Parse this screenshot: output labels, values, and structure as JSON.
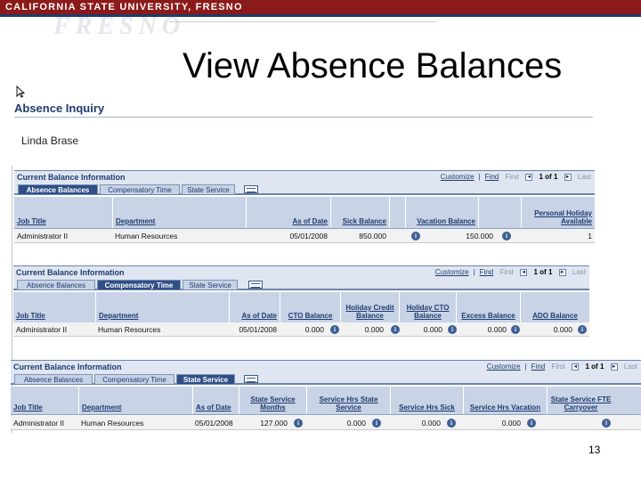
{
  "banner": {
    "text": "CALIFORNIA STATE UNIVERSITY, FRESNO",
    "watermark": "FRESNO",
    "color": "#8b1a1a",
    "accent": "#1f3b6e"
  },
  "slide": {
    "title": "View Absence Balances",
    "page_number": "13"
  },
  "inquiry": {
    "title": "Absence Inquiry",
    "employee": "Linda Brase"
  },
  "panels": [
    {
      "title": "Current Balance Information",
      "nav": {
        "customize": "Customize",
        "find": "Find",
        "first": "First",
        "prev": "◄",
        "pos": "1 of 1",
        "next": "►",
        "last": "Last"
      },
      "tabs": [
        "Absence Balances",
        "Compensatory Time",
        "State Service"
      ],
      "active_tab": 0,
      "headers": [
        "Job Title",
        "Department",
        "As of Date",
        "Sick Balance",
        "Vacation Balance",
        "Personal Holiday Available"
      ],
      "row": [
        "Administrator II",
        "Human Resources",
        "05/01/2008",
        "850.000",
        "150.000",
        "1"
      ]
    },
    {
      "title": "Current Balance Information",
      "nav": {
        "customize": "Customize",
        "find": "Find",
        "first": "First",
        "prev": "◄",
        "pos": "1 of 1",
        "next": "►",
        "last": "Last"
      },
      "tabs": [
        "Absence Balances",
        "Compensatory Time",
        "State Service"
      ],
      "active_tab": 1,
      "headers": [
        "Job Title",
        "Department",
        "As of Date",
        "CTO Balance",
        "Holiday Credit Balance",
        "Holiday CTO Balance",
        "Excess Balance",
        "ADO Balance"
      ],
      "row": [
        "Administrator II",
        "Human Resources",
        "05/01/2008",
        "0.000",
        "0.000",
        "0.000",
        "0.000",
        "0.000"
      ]
    },
    {
      "title": "Current Balance Information",
      "nav": {
        "customize": "Customize",
        "find": "Find",
        "first": "First",
        "prev": "◄",
        "pos": "1 of 1",
        "next": "►",
        "last": "Last"
      },
      "tabs": [
        "Absence Balances",
        "Compensatory Time",
        "State Service"
      ],
      "active_tab": 2,
      "headers": [
        "Job Title",
        "Department",
        "As of Date",
        "State Service Months",
        "Service Hrs State Service",
        "Service Hrs Sick",
        "Service Hrs Vacation",
        "State Service FTE Carryover"
      ],
      "row": [
        "Administrator II",
        "Human Resources",
        "05/01/2008",
        "127.000",
        "0.000",
        "0.000",
        "0.000",
        ""
      ]
    }
  ]
}
